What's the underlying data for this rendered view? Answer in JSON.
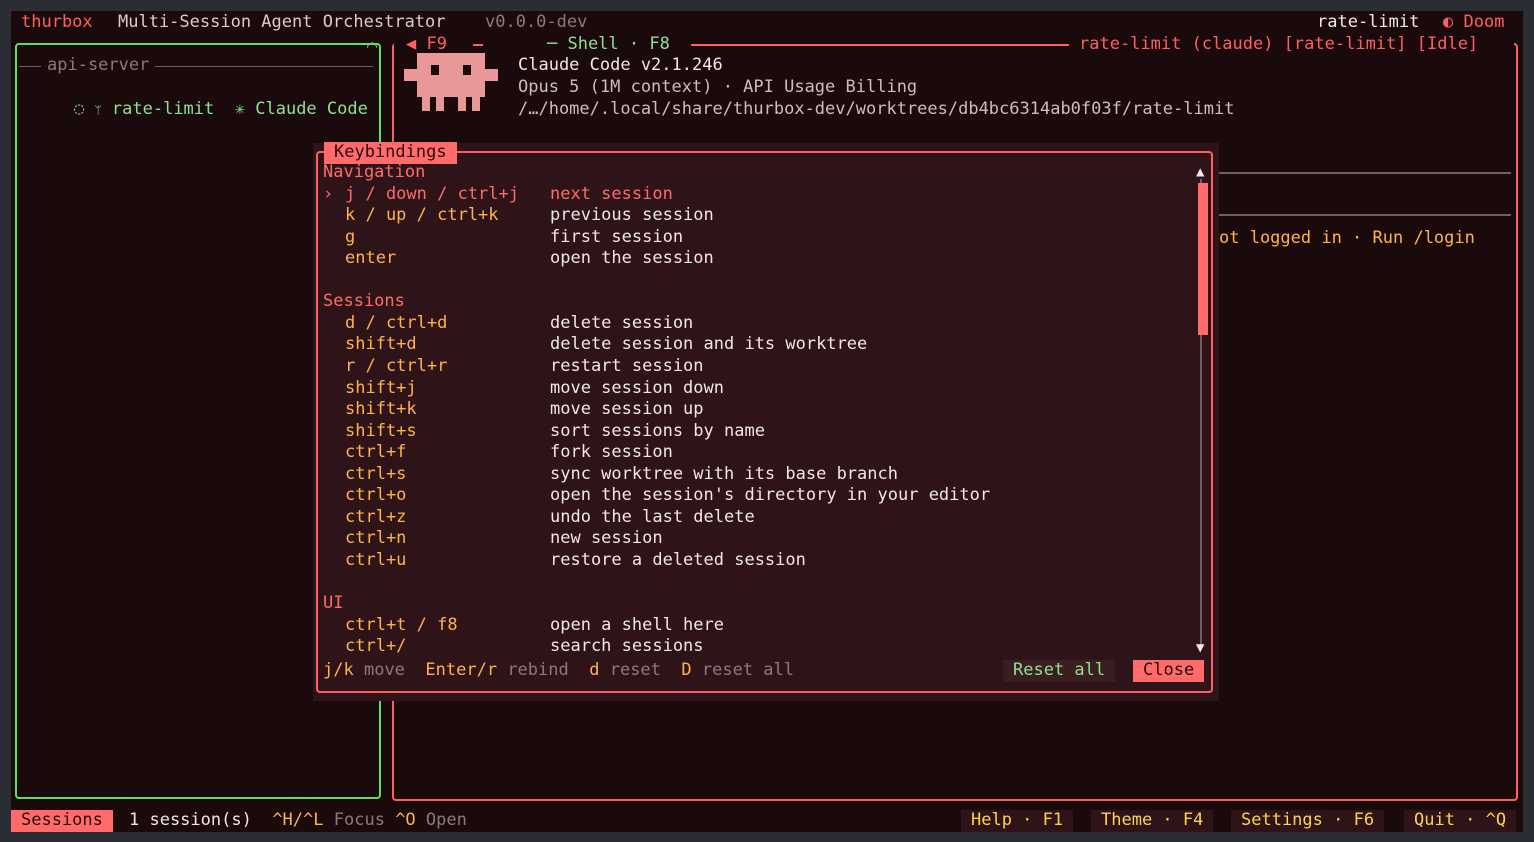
{
  "topbar": {
    "app_name": "thurbox",
    "subtitle": "Multi-Session Agent Orchestrator",
    "version": "v0.0.0-dev",
    "active_session": "rate-limit",
    "theme_glyph": "◐",
    "theme_name": "Doom"
  },
  "left_panel": {
    "title": "api-server",
    "corner": "◠",
    "session": {
      "spinner": "◌",
      "branch_icon": "ᛘ",
      "name": "rate-limit",
      "agent_star": "✳",
      "agent": "Claude Code"
    }
  },
  "right_panel": {
    "tab_f9": "◀ F9",
    "tab_shell": "─ Shell · F8",
    "title": "rate-limit (claude) [rate-limit] [Idle]",
    "claude_version": "Claude Code v2.1.246",
    "model_line": "Opus 5 (1M context) · API Usage Billing",
    "path": "/…/home/.local/share/thurbox-dev/worktrees/db4bc6314ab0f03f/rate-limit",
    "login_hint": "ot logged in · Run /login"
  },
  "modal": {
    "title": "Keybindings",
    "sections": [
      {
        "name": "Navigation",
        "rows": [
          {
            "caret": "›",
            "key": "j / down / ctrl+j",
            "desc": "next session",
            "selected": true
          },
          {
            "key": "k / up / ctrl+k",
            "desc": "previous session"
          },
          {
            "key": "g",
            "desc": "first session"
          },
          {
            "key": "enter",
            "desc": "open the session"
          }
        ]
      },
      {
        "name": "Sessions",
        "rows": [
          {
            "key": "d / ctrl+d",
            "desc": "delete session"
          },
          {
            "key": "shift+d",
            "desc": "delete session and its worktree"
          },
          {
            "key": "r / ctrl+r",
            "desc": "restart session"
          },
          {
            "key": "shift+j",
            "desc": "move session down"
          },
          {
            "key": "shift+k",
            "desc": "move session up"
          },
          {
            "key": "shift+s",
            "desc": "sort sessions by name"
          },
          {
            "key": "ctrl+f",
            "desc": "fork session"
          },
          {
            "key": "ctrl+s",
            "desc": "sync worktree with its base branch"
          },
          {
            "key": "ctrl+o",
            "desc": "open the session's directory in your editor"
          },
          {
            "key": "ctrl+z",
            "desc": "undo the last delete"
          },
          {
            "key": "ctrl+n",
            "desc": "new session"
          },
          {
            "key": "ctrl+u",
            "desc": "restore a deleted session"
          }
        ]
      },
      {
        "name": "UI",
        "rows": [
          {
            "key": "ctrl+t / f8",
            "desc": "open a shell here"
          },
          {
            "key": "ctrl+/",
            "desc": "search sessions"
          }
        ]
      }
    ],
    "scroll_up": "▲",
    "scroll_down": "▼",
    "footer": {
      "move_key": "j/k",
      "move_label": "move",
      "rebind_key": "Enter/r",
      "rebind_label": "rebind",
      "reset_key": "d",
      "reset_label": "reset",
      "reset_all_key": "D",
      "reset_all_label": "reset all"
    },
    "reset_all_button": "Reset all",
    "close_button": "Close"
  },
  "statusbar": {
    "sessions_tab": "Sessions",
    "session_count": "1 session(s)",
    "focus_key": "^H/^L",
    "focus_label": "Focus",
    "open_key": "^O",
    "open_label": "Open",
    "help": "Help · F1",
    "theme": "Theme · F4",
    "settings": "Settings · F6",
    "quit": "Quit · ^Q"
  },
  "colors": {
    "accent_red": "#ff5f5f",
    "accent_green": "#5fe05f",
    "key_orange": "#ffb44a",
    "background": "#1b0a0c",
    "modal_bg": "#2e1418"
  },
  "icons": [
    "spinner-icon",
    "branch-icon",
    "star-icon",
    "mascot-icon",
    "moon-icon",
    "arrow-left-icon"
  ]
}
